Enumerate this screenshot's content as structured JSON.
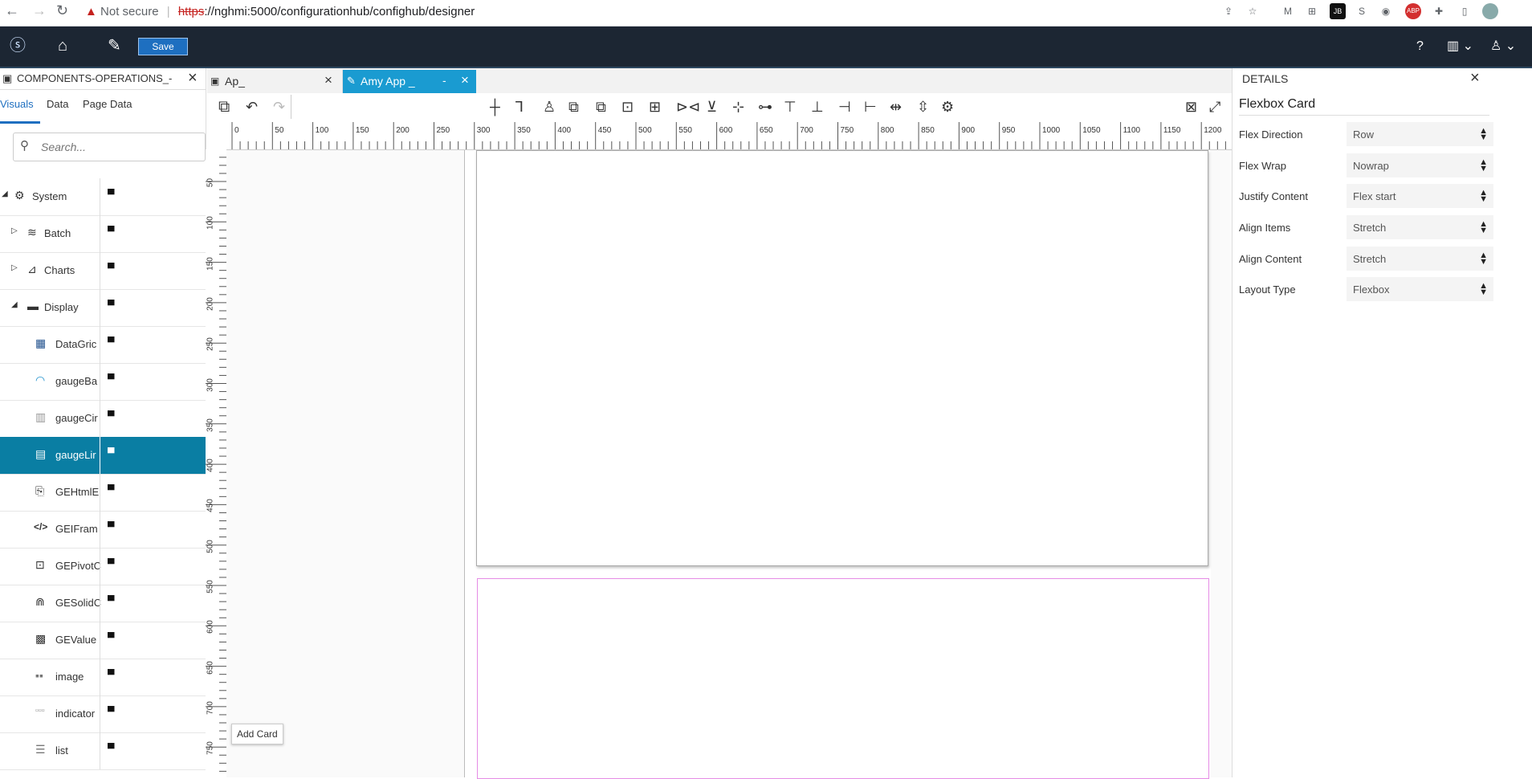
{
  "browser": {
    "security_label": "Not secure",
    "url_scheme": "https",
    "url_rest": "://nghmi:5000/configurationhub/confighub/designer",
    "extension_icons": [
      "share-icon",
      "star-icon",
      "gmail-icon",
      "extension-icon",
      "jb-icon",
      "skype-icon",
      "camera-icon",
      "abp-icon",
      "puzzle-icon",
      "sidepanel-icon",
      "profile-avatar-icon"
    ]
  },
  "app_header": {
    "save_label": "Save"
  },
  "left_panel": {
    "title": "COMPONENTS-OPERATIONS_-",
    "tabs": [
      "Visuals",
      "Data",
      "Page Data"
    ],
    "active_tab": "Visuals",
    "search_placeholder": "Search...",
    "items": [
      {
        "label": "System",
        "icon": "gears-icon",
        "expander": "expanded"
      },
      {
        "label": "Batch",
        "icon": "layers-icon",
        "expander": "collapsed"
      },
      {
        "label": "Charts",
        "icon": "chart-icon",
        "expander": "collapsed"
      },
      {
        "label": "Display",
        "icon": "monitor-icon",
        "expander": "expanded"
      },
      {
        "label": "DataGric",
        "icon": "datagrid-icon",
        "expander": "none"
      },
      {
        "label": "gaugeBa",
        "icon": "gauge-bar-icon",
        "expander": "none"
      },
      {
        "label": "gaugeCir",
        "icon": "gauge-circle-icon",
        "expander": "none"
      },
      {
        "label": "gaugeLir",
        "icon": "gauge-linear-icon",
        "expander": "none",
        "selected": true
      },
      {
        "label": "GEHtmlE",
        "icon": "html-icon",
        "expander": "none"
      },
      {
        "label": "GEIFram",
        "icon": "code-icon",
        "expander": "none"
      },
      {
        "label": "GEPivotC",
        "icon": "pivot-icon",
        "expander": "none"
      },
      {
        "label": "GESolidC",
        "icon": "solid-gauge-icon",
        "expander": "none"
      },
      {
        "label": "GEValue",
        "icon": "value-icon",
        "expander": "none"
      },
      {
        "label": "image",
        "icon": "image-icon",
        "expander": "none"
      },
      {
        "label": "indicator",
        "icon": "indicator-icon",
        "expander": "none"
      },
      {
        "label": "list",
        "icon": "list-icon",
        "expander": "none"
      }
    ]
  },
  "doc_tabs": [
    {
      "label": "Ap_",
      "active": false
    },
    {
      "label": "Amy App _",
      "active": true,
      "extra": "-"
    }
  ],
  "rulers": {
    "horizontal": [
      "0",
      "50",
      "100",
      "150",
      "200",
      "250",
      "300",
      "350",
      "400",
      "450",
      "500",
      "550",
      "600",
      "650",
      "700",
      "750",
      "800",
      "850",
      "900",
      "950",
      "1000",
      "1050",
      "1100",
      "1150",
      "1200"
    ],
    "vertical": [
      "50",
      "100",
      "150",
      "200",
      "250",
      "300",
      "350",
      "400",
      "450",
      "500",
      "550",
      "600",
      "650",
      "700",
      "750"
    ]
  },
  "canvas": {
    "add_card_label": "Add Card"
  },
  "details": {
    "title": "DETAILS",
    "component_name": "Flexbox Card",
    "properties": [
      {
        "label": "Flex Direction",
        "value": "Row"
      },
      {
        "label": "Flex Wrap",
        "value": "Nowrap"
      },
      {
        "label": "Justify Content",
        "value": "Flex start"
      },
      {
        "label": "Align Items",
        "value": "Stretch"
      },
      {
        "label": "Align Content",
        "value": "Stretch"
      },
      {
        "label": "Layout Type",
        "value": "Flexbox"
      }
    ]
  },
  "colors": {
    "header_bg": "#1c2633",
    "accent": "#1e6fc0",
    "selected_row": "#0a7ea3",
    "active_tab": "#1a9bd1",
    "card_outline_pink": "#e58ce5"
  }
}
